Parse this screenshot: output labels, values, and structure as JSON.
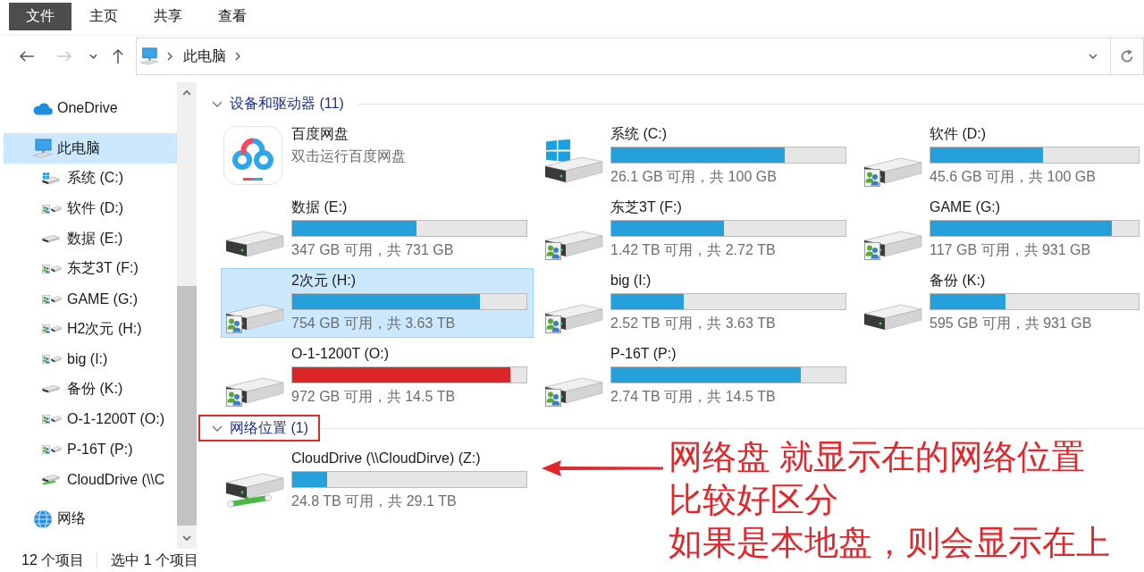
{
  "ribbon": {
    "tabs": [
      {
        "label": "文件",
        "kind": "file"
      },
      {
        "label": "主页",
        "kind": "tab"
      },
      {
        "label": "共享",
        "kind": "tab"
      },
      {
        "label": "查看",
        "kind": "tab"
      }
    ]
  },
  "navigation": {
    "buttons": [
      {
        "kind": "back",
        "disabled": false
      },
      {
        "kind": "forward",
        "disabled": true
      },
      {
        "kind": "recent",
        "disabled": false
      },
      {
        "kind": "up",
        "disabled": false
      }
    ]
  },
  "address_bar": {
    "path": [
      "此电脑"
    ]
  },
  "sidebar": {
    "items": [
      {
        "label": "OneDrive",
        "kind": "cloud",
        "selected": false
      },
      {
        "label": "此电脑",
        "kind": "computer",
        "selected": true,
        "children": [
          {
            "label": "系统 (C:)",
            "kind": "system",
            "shared": false,
            "selected": false
          },
          {
            "label": "软件 (D:)",
            "kind": "local",
            "shared": true,
            "selected": false
          },
          {
            "label": "数据 (E:)",
            "kind": "local",
            "shared": false,
            "selected": false
          },
          {
            "label": "东芝3T (F:)",
            "kind": "local",
            "shared": true,
            "selected": false
          },
          {
            "label": "GAME (G:)",
            "kind": "local",
            "shared": true,
            "selected": false
          },
          {
            "label": "H2次元 (H:)",
            "kind": "local",
            "shared": true,
            "selected": false
          },
          {
            "label": "big (I:)",
            "kind": "local",
            "shared": true,
            "selected": false
          },
          {
            "label": "备份 (K:)",
            "kind": "local",
            "shared": false,
            "selected": false
          },
          {
            "label": "O-1-1200T (O:)",
            "kind": "local",
            "shared": true,
            "selected": false
          },
          {
            "label": "P-16T (P:)",
            "kind": "local",
            "shared": true,
            "selected": false
          },
          {
            "label": "CloudDrive (\\\\C",
            "kind": "network",
            "shared": false,
            "selected": false
          }
        ]
      },
      {
        "label": "网络",
        "kind": "network",
        "selected": false
      }
    ]
  },
  "groups": [
    {
      "title": "设备和驱动器 (11)",
      "expanded": true,
      "highlighted": false,
      "items": [
        {
          "kind": "app",
          "name": "百度网盘",
          "subtitle": "双击运行百度网盘",
          "selected": false
        },
        {
          "kind": "system",
          "name": "系统 (C:)",
          "shared": false,
          "level": 0.74,
          "low_space": false,
          "space": "26.1 GB 可用，共 100 GB",
          "selected": false
        },
        {
          "kind": "local",
          "name": "软件 (D:)",
          "shared": true,
          "level": 0.54,
          "low_space": false,
          "space": "45.6 GB 可用，共 100 GB",
          "selected": false
        },
        {
          "kind": "local",
          "name": "数据 (E:)",
          "shared": false,
          "level": 0.53,
          "low_space": false,
          "space": "347 GB 可用，共 731 GB",
          "selected": false
        },
        {
          "kind": "local",
          "name": "东芝3T (F:)",
          "shared": true,
          "level": 0.48,
          "low_space": false,
          "space": "1.42 TB 可用，共 2.72 TB",
          "selected": false
        },
        {
          "kind": "local",
          "name": "GAME (G:)",
          "shared": true,
          "level": 0.87,
          "low_space": false,
          "space": "117 GB 可用，共 931 GB",
          "selected": false
        },
        {
          "kind": "local",
          "name": "2次元 (H:)",
          "shared": true,
          "level": 0.8,
          "low_space": false,
          "space": "754 GB 可用，共 3.63 TB",
          "selected": true
        },
        {
          "kind": "local",
          "name": "big (I:)",
          "shared": true,
          "level": 0.31,
          "low_space": false,
          "space": "2.52 TB 可用，共 3.63 TB",
          "selected": false
        },
        {
          "kind": "local",
          "name": "备份 (K:)",
          "shared": false,
          "level": 0.36,
          "low_space": false,
          "space": "595 GB 可用，共 931 GB",
          "selected": false
        },
        {
          "kind": "local",
          "name": "O-1-1200T (O:)",
          "shared": true,
          "level": 0.93,
          "low_space": true,
          "space": "972 GB 可用，共 14.5 TB",
          "selected": false
        },
        {
          "kind": "local",
          "name": "P-16T (P:)",
          "shared": true,
          "level": 0.81,
          "low_space": false,
          "space": "2.74 TB 可用，共 14.5 TB",
          "selected": false
        }
      ]
    },
    {
      "title": "网络位置 (1)",
      "expanded": true,
      "highlighted": true,
      "items": [
        {
          "kind": "network",
          "name": "CloudDrive (\\\\CloudDirve) (Z:)",
          "shared": false,
          "level": 0.15,
          "low_space": false,
          "space": "24.8 TB 可用，共 29.1 TB",
          "selected": false
        }
      ]
    }
  ],
  "status_bar": {
    "item_count": "12 个项目",
    "selection": "选中 1 个项目"
  },
  "annotation": {
    "lines": [
      "网络盘 就显示在的网络位置",
      "比较好区分",
      "如果是本地盘，则会显示在上"
    ]
  }
}
